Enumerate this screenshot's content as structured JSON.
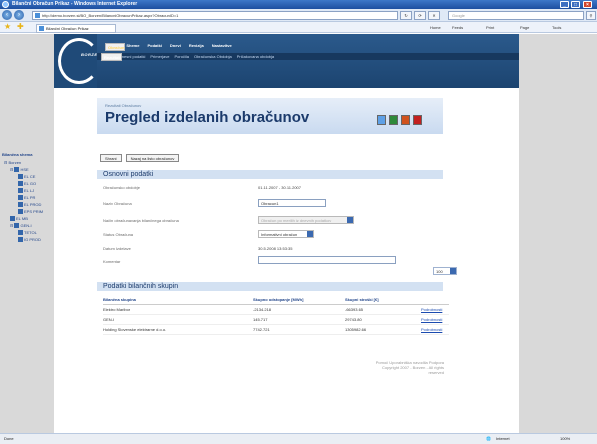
{
  "window": {
    "title": "Bilančni Obračun Prikaz - Windows Internet Explorer"
  },
  "address": {
    "url": "http://demo.borzen.si/BO_Borzen/BilancniObracunPrikaz.aspx?ObracunID=1",
    "search_placeholder": "Google"
  },
  "favorites": {
    "tab_label": "Bilančni Obračun Prikaz",
    "home": "Home",
    "feeds": "Feeds",
    "print": "Print",
    "page": "Page",
    "tools": "Tools"
  },
  "topnav": {
    "logo": "BORZEN",
    "menu": [
      "Odjava",
      "Sheme",
      "Obračun",
      "Podatki",
      "Dnevi",
      "Revizija",
      "Nastavitve"
    ],
    "submenu": [
      "Rezultati",
      "Izračun",
      "Vnesni podatki",
      "Primerjave",
      "Poročila",
      "Obračunska Obdobja",
      "Pričakovana obdobja"
    ]
  },
  "page": {
    "breadcrumb": "Rezultati Obračunov",
    "title": "Pregled izdelanih obračunov"
  },
  "sidebar": {
    "title": "Bilančna shema",
    "root": "Borzen",
    "items": [
      "HSE",
      "EL CE",
      "EL GO",
      "EL LJ",
      "EL PR",
      "EL PROD",
      "EPS PRIM",
      "EL MB",
      "GEN-I",
      "TETOL",
      "IG PROD"
    ]
  },
  "buttons": {
    "back": "Shrani",
    "back_list": "Nazaj na listo obračunov"
  },
  "osnovni": {
    "title": "Osnovni podatki",
    "obdobje_label": "Obračunsko obdobje",
    "obdobje_value": "01.11.2007 - 30.11.2007",
    "naziv_label": "Naziv Obračuna",
    "naziv_value": "Obracun1",
    "nacin_label": "Način obračunavanja bilančnega obračuna",
    "nacin_value": "Obračun po merilih iz dnevnih podatkov",
    "status_label": "Status Obračuna",
    "status_value": "Informativni obračun",
    "datum_label": "Datum Izdelave",
    "datum_value": "30.5.2008 13:53:35",
    "komentar_label": "Komentar"
  },
  "pager": {
    "value": "100"
  },
  "bilancne": {
    "title": "Podatki bilančnih skupin",
    "headers": [
      "Bilančna skupina",
      "Skupno odstopanje [MWh]",
      "Skupni stroški [€]",
      ""
    ],
    "rows": [
      [
        "Elektro Maribor",
        "-2134.218",
        "-66393.65",
        "Podrobnosti"
      ],
      [
        "GEN-I",
        "145.717",
        "29743.80",
        "Podrobnosti"
      ],
      [
        "Holding Slovenske elektrarne d.o.o.",
        "7742.721",
        "1305982.66",
        "Podrobnosti"
      ]
    ]
  },
  "footer": {
    "line1": "Pomoč Uporabniška navodila Podpora",
    "line2": "Copyright 2007 - Borzen - All rights reserved"
  },
  "status": {
    "left": "Done",
    "zone": "Internet",
    "zoom": "100%"
  }
}
